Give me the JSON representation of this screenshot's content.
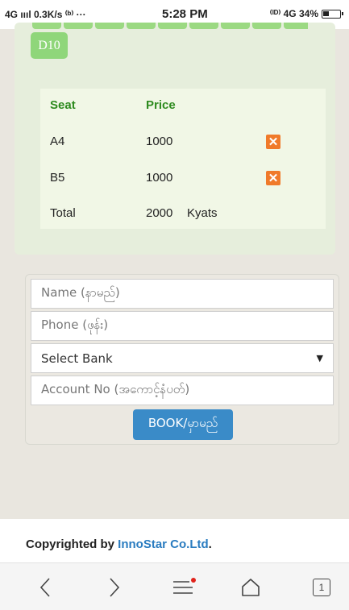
{
  "status_bar": {
    "left": "4G ıııl 0.3K/s ⁽ᵇ⁾ ···",
    "time": "5:28 PM",
    "right": "⁽ᴵᴰ⁾ 4G 34%"
  },
  "seat_map": {
    "selected_seat_label": "D10"
  },
  "summary": {
    "headers": {
      "seat": "Seat",
      "price": "Price"
    },
    "rows": [
      {
        "seat": "A4",
        "price": "1000",
        "remove": "✕"
      },
      {
        "seat": "B5",
        "price": "1000",
        "remove": "✕"
      }
    ],
    "total": {
      "label": "Total",
      "amount": "2000",
      "currency": "Kyats"
    }
  },
  "form": {
    "name_placeholder": "Name (နာမည်)",
    "phone_placeholder": "Phone (ဖုန်း)",
    "bank_select": "Select Bank",
    "account_placeholder": "Account No (အကောင့်နံပတ်)",
    "book_label": "BOOK/မှာမည်"
  },
  "footer": {
    "copyright_prefix": "Copyrighted by ",
    "company": "InnoStar Co.Ltd",
    "suffix": "."
  },
  "browser_nav": {
    "tab_count": "1"
  },
  "colors": {
    "seat_green": "#8fd67a",
    "header_green": "#2e8b1f",
    "remove_orange": "#f07a2a",
    "button_blue": "#3a8bc8",
    "link_blue": "#2a7cc0"
  }
}
